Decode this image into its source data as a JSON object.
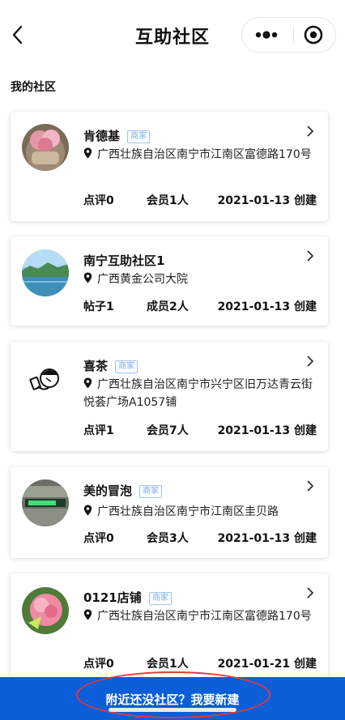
{
  "header": {
    "title": "互助社区",
    "back_icon": "chevron-left-icon",
    "more_icon": "more-dots-icon",
    "close_icon": "target-circle-icon"
  },
  "section": {
    "title": "我的社区"
  },
  "cards": [
    {
      "name": "肯德基",
      "badge": "商家",
      "address": "广西壮族自治区南宁市江南区富德路170号",
      "stat1": "点评0",
      "stat2": "会员1人",
      "created": "2021-01-13 创建",
      "avatar": "pink-flower-gift-avatar"
    },
    {
      "name": "南宁互助社区1",
      "badge": "",
      "address": "广西黄金公司大院",
      "stat1": "帖子1",
      "stat2": "成员2人",
      "created": "2021-01-13 创建",
      "avatar": "lake-landscape-avatar"
    },
    {
      "name": "喜茶",
      "badge": "商家",
      "address": "广西壮族自治区南宁市兴宁区旧万达青云街悦荟广场A1057铺",
      "stat1": "点评1",
      "stat2": "会员7人",
      "created": "2021-01-13 创建",
      "avatar": "drinking-person-logo-avatar"
    },
    {
      "name": "美的冒泡",
      "badge": "商家",
      "address": "广西壮族自治区南宁市江南区圭贝路",
      "stat1": "点评0",
      "stat2": "会员3人",
      "created": "2021-01-13 创建",
      "avatar": "green-display-avatar"
    },
    {
      "name": "0121店铺",
      "badge": "商家",
      "address": "广西壮族自治区南宁市江南区富德路170号",
      "stat1": "点评0",
      "stat2": "会员1人",
      "created": "2021-01-21 创建",
      "avatar": "pink-flower-avatar"
    }
  ],
  "bottom": {
    "label": "附近还没社区？我要新建"
  },
  "colors": {
    "accent": "#0b5ed8",
    "badge": "#74a9e8",
    "annotation": "#e23a3a"
  }
}
